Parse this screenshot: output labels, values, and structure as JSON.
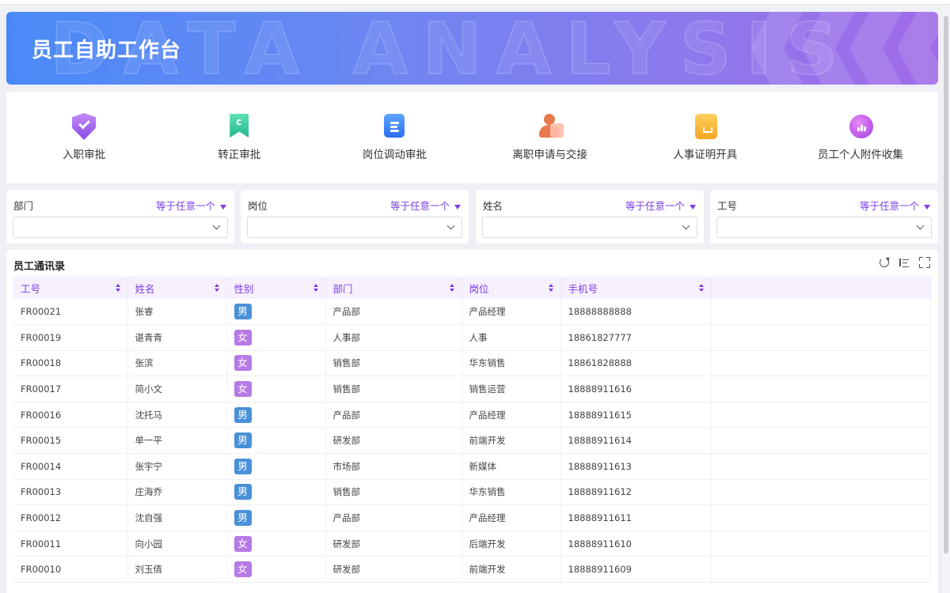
{
  "banner": {
    "title": "员工自助工作台",
    "watermark": "DATA ANALYSIS"
  },
  "quick_actions": [
    {
      "label": "入职审批",
      "icon": "shield-check-icon"
    },
    {
      "label": "转正审批",
      "icon": "bookmark-icon"
    },
    {
      "label": "岗位调动审批",
      "icon": "document-icon"
    },
    {
      "label": "离职申请与交接",
      "icon": "person-transfer-icon"
    },
    {
      "label": "人事证明开具",
      "icon": "envelope-icon"
    },
    {
      "label": "员工个人附件收集",
      "icon": "chart-icon"
    }
  ],
  "filters": [
    {
      "label": "部门",
      "operator": "等于任意一个",
      "value": ""
    },
    {
      "label": "岗位",
      "operator": "等于任意一个",
      "value": ""
    },
    {
      "label": "姓名",
      "operator": "等于任意一个",
      "value": ""
    },
    {
      "label": "工号",
      "operator": "等于任意一个",
      "value": ""
    }
  ],
  "table": {
    "title": "员工通讯录",
    "columns": [
      "工号",
      "姓名",
      "性别",
      "部门",
      "岗位",
      "手机号"
    ],
    "gender_colors": {
      "男": "#4a90d9",
      "女": "#b57ae6"
    },
    "rows": [
      {
        "id": "FR00021",
        "name": "张睿",
        "gender": "男",
        "dept": "产品部",
        "post": "产品经理",
        "phone": "18888888888"
      },
      {
        "id": "FR00019",
        "name": "谌青青",
        "gender": "女",
        "dept": "人事部",
        "post": "人事",
        "phone": "18861827777"
      },
      {
        "id": "FR00018",
        "name": "张滨",
        "gender": "女",
        "dept": "销售部",
        "post": "华东销售",
        "phone": "18861828888"
      },
      {
        "id": "FR00017",
        "name": "简小文",
        "gender": "女",
        "dept": "销售部",
        "post": "销售运营",
        "phone": "18888911616"
      },
      {
        "id": "FR00016",
        "name": "沈托马",
        "gender": "男",
        "dept": "产品部",
        "post": "产品经理",
        "phone": "18888911615"
      },
      {
        "id": "FR00015",
        "name": "单一平",
        "gender": "男",
        "dept": "研发部",
        "post": "前端开发",
        "phone": "18888911614"
      },
      {
        "id": "FR00014",
        "name": "张宇宁",
        "gender": "男",
        "dept": "市场部",
        "post": "新媒体",
        "phone": "18888911613"
      },
      {
        "id": "FR00013",
        "name": "庄海乔",
        "gender": "男",
        "dept": "销售部",
        "post": "华东销售",
        "phone": "18888911612"
      },
      {
        "id": "FR00012",
        "name": "沈自强",
        "gender": "男",
        "dept": "产品部",
        "post": "产品经理",
        "phone": "18888911611"
      },
      {
        "id": "FR00011",
        "name": "向小园",
        "gender": "女",
        "dept": "研发部",
        "post": "后端开发",
        "phone": "18888911610"
      },
      {
        "id": "FR00010",
        "name": "刘玉倩",
        "gender": "女",
        "dept": "研发部",
        "post": "前端开发",
        "phone": "18888911609"
      }
    ]
  }
}
